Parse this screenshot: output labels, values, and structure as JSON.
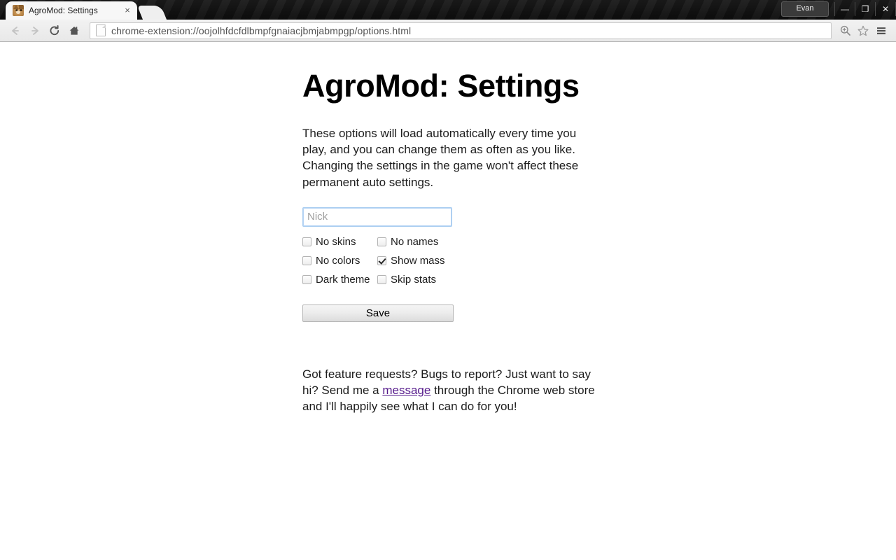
{
  "browser": {
    "tab": {
      "title": "AgroMod: Settings",
      "favicon": "doge-favicon",
      "close_label": "×"
    },
    "newtab_label": "",
    "window": {
      "profile_label": "Evan",
      "minimize_label": "—",
      "maximize_label": "❐",
      "close_label": "✕"
    },
    "toolbar": {
      "back_label": "Back",
      "forward_label": "Forward",
      "reload_label": "Reload",
      "home_label": "Home",
      "url": "chrome-extension://oojolhfdcfdlbmpfgnaiacjbmjabmpgp/options.html",
      "zoom_icon_label": "zoom-in",
      "bookmark_icon_label": "bookmark-star",
      "menu_icon_label": "menu"
    }
  },
  "page": {
    "title": "AgroMod: Settings",
    "intro": "These options will load automatically every time you play, and you can change them as often as you like. Changing the settings in the game won't affect these permanent auto settings.",
    "nick_field": {
      "placeholder": "Nick",
      "value": ""
    },
    "checkboxes": [
      {
        "id": "no-skins",
        "label": "No skins",
        "checked": false
      },
      {
        "id": "no-names",
        "label": "No names",
        "checked": false
      },
      {
        "id": "no-colors",
        "label": "No colors",
        "checked": false
      },
      {
        "id": "show-mass",
        "label": "Show mass",
        "checked": true
      },
      {
        "id": "dark-theme",
        "label": "Dark theme",
        "checked": false
      },
      {
        "id": "skip-stats",
        "label": "Skip stats",
        "checked": false
      }
    ],
    "save_label": "Save",
    "outro": {
      "before": "Got feature requests? Bugs to report? Just want to say hi? Send me a ",
      "link": "message",
      "after": " through the Chrome web store and I'll happily see what I can do for you!"
    }
  },
  "colors": {
    "link": "#551a8b",
    "titlebar": "#151515",
    "focus_border": "#a9cdf0"
  }
}
